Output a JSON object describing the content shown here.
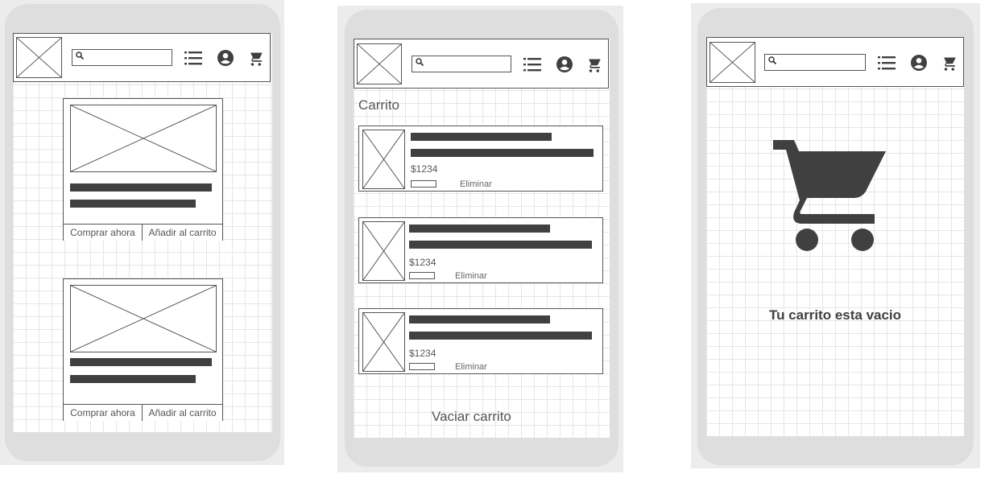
{
  "buttons": {
    "buy_now": "Comprar ahora",
    "add_to_cart": "Añadir al carrito"
  },
  "cart": {
    "title": "Carrito",
    "items": [
      {
        "price": "$1234",
        "delete_label": "Eliminar"
      },
      {
        "price": "$1234",
        "delete_label": "Eliminar"
      },
      {
        "price": "$1234",
        "delete_label": "Eliminar"
      }
    ],
    "clear_label": "Vaciar carrito"
  },
  "empty_cart": {
    "message": "Tu carrito esta vacio"
  },
  "icons": {
    "logo": "image-placeholder-icon",
    "search": "search-icon",
    "menu": "list-icon",
    "account": "account-circle-icon",
    "cart": "shopping-cart-icon"
  },
  "colors": {
    "frame": "#dedede",
    "dark_bar": "#404040",
    "grid": "#e6e6e6",
    "stroke": "#555555"
  }
}
